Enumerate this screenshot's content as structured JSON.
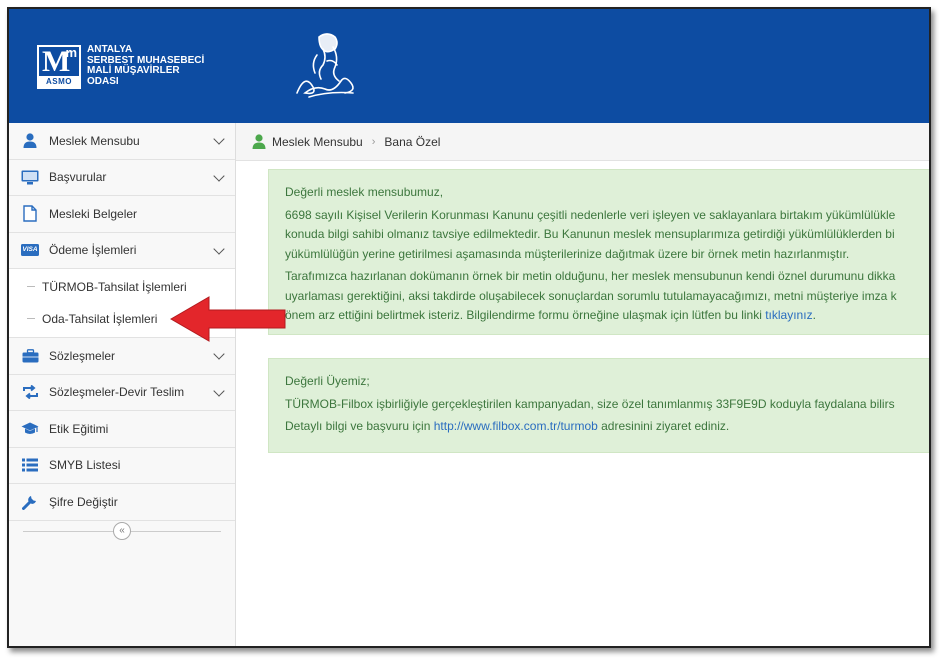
{
  "header": {
    "logo": {
      "mark_big": "M",
      "mark_small": "m",
      "mark_tag": "ASMO",
      "lines": [
        "ANTALYA",
        "SERBEST MUHASEBECİ",
        "MALİ MÜŞAVİRLER",
        "ODASI"
      ]
    },
    "emblem_icon": "ataturk-signature-emblem"
  },
  "sidebar": {
    "items": [
      {
        "label": "Meslek Mensubu",
        "icon": "user-icon",
        "chevron": true
      },
      {
        "label": "Başvurular",
        "icon": "monitor-icon",
        "chevron": true
      },
      {
        "label": "Mesleki Belgeler",
        "icon": "document-icon",
        "chevron": false
      },
      {
        "label": "Ödeme İşlemleri",
        "icon": "visa-icon",
        "chevron": true
      },
      {
        "label": "Sözleşmeler",
        "icon": "briefcase-icon",
        "chevron": true
      },
      {
        "label": "Sözleşmeler-Devir Teslim",
        "icon": "transfer-icon",
        "chevron": true
      },
      {
        "label": "Etik Eğitimi",
        "icon": "graduation-cap-icon",
        "chevron": false
      },
      {
        "label": "SMYB Listesi",
        "icon": "list-icon",
        "chevron": false
      },
      {
        "label": "Şifre Değiştir",
        "icon": "wrench-icon",
        "chevron": false
      }
    ],
    "payment_subitems": [
      "TÜRMOB-Tahsilat İşlemleri",
      "Oda-Tahsilat İşlemleri"
    ],
    "collapse_symbol": "«",
    "visa_text": "VISA"
  },
  "breadcrumb": {
    "items": [
      "Meslek Mensubu",
      "Bana Özel"
    ],
    "separator": "›"
  },
  "notice1": {
    "greeting": "Değerli meslek mensubumuz,",
    "p1_line1": "6698 sayılı Kişisel Verilerin Korunması Kanunu çeşitli nedenlerle veri işleyen ve saklayanlara birtakım yükümlülükle",
    "p1_line2": "konuda bilgi sahibi olmanız tavsiye edilmektedir. Bu Kanunun meslek mensuplarımıza getirdiği yükümlülüklerden bi",
    "p1_line3": "yükümlülüğün yerine getirilmesi aşamasında müşterilerinize dağıtmak üzere bir örnek metin hazırlanmıştır.",
    "p2_line1": "Tarafımızca hazırlanan dokümanın örnek bir metin olduğunu, her meslek mensubunun kendi öznel durumunu dikka",
    "p2_line2": "uyarlaması gerektiğini, aksi takdirde oluşabilecek sonuçlardan sorumlu tutulamayacağımızı, metni müşteriye imza k",
    "p2_line3": "önem arz ettiğini belirtmek isteriz. Bilgilendirme formu örneğine ulaşmak için lütfen bu linki ",
    "p2_link": "tıklayınız",
    "p2_end": "."
  },
  "notice2": {
    "greeting": "Değerli Üyemiz;",
    "line1": "TÜRMOB-Filbox işbirliğiyle gerçekleştirilen kampanyadan, size özel tanımlanmış 33F9E9D koduyla faydalana bilirs",
    "line2_pre": "Detaylı bilgi ve başvuru için ",
    "line2_link": "http://www.filbox.com.tr/turmob",
    "line2_post": " adresinini ziyaret ediniz."
  },
  "colors": {
    "header_bg": "#0d4ca2",
    "alert_bg": "#dff0d8",
    "alert_text": "#3c763d",
    "link": "#2a6dbf",
    "arrow": "#e3262b"
  }
}
